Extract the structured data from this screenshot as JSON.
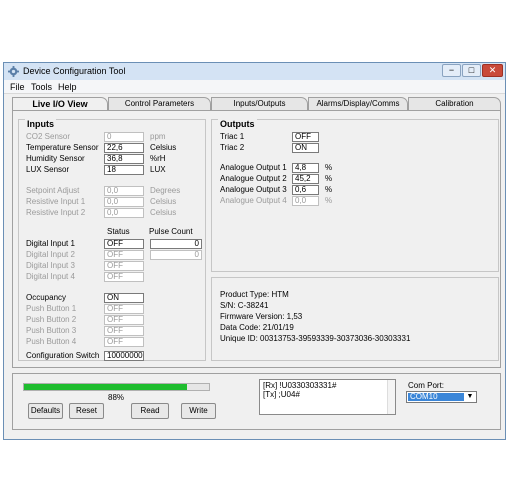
{
  "window": {
    "title": "Device Configuration Tool",
    "minimize": "−",
    "maximize": "□",
    "close": "✕"
  },
  "menu": [
    "File",
    "Tools",
    "Help"
  ],
  "tabs": [
    "Live  I/O View",
    "Control Parameters",
    "Inputs/Outputs",
    "Alarms/Display/Comms",
    "Calibration"
  ],
  "inputs": {
    "title": "Inputs",
    "sensors": [
      {
        "label": "CO2 Sensor",
        "value": "0",
        "unit": "ppm"
      },
      {
        "label": "Temperature Sensor",
        "value": "22,6",
        "unit": "Celsius"
      },
      {
        "label": "Humidity Sensor",
        "value": "36,8",
        "unit": "%rH"
      },
      {
        "label": "LUX Sensor",
        "value": "18",
        "unit": "LUX"
      }
    ],
    "setpoints": [
      {
        "label": "Setpoint Adjust",
        "value": "0,0",
        "unit": "Degrees"
      },
      {
        "label": "Resistive Input 1",
        "value": "0,0",
        "unit": "Celsius"
      },
      {
        "label": "Resistive Input 2",
        "value": "0,0",
        "unit": "Celsius"
      }
    ],
    "status_header": "Status",
    "pulse_header": "Pulse Count",
    "digital": [
      {
        "label": "Digital Input 1",
        "value": "OFF",
        "pulse": "0"
      },
      {
        "label": "Digital Input 2",
        "value": "OFF",
        "pulse": "0"
      },
      {
        "label": "Digital Input 3",
        "value": "OFF"
      },
      {
        "label": "Digital Input 4",
        "value": "OFF"
      }
    ],
    "occupancy": {
      "label": "Occupancy",
      "value": "ON"
    },
    "push": [
      {
        "label": "Push Button 1",
        "value": "OFF"
      },
      {
        "label": "Push Button 2",
        "value": "OFF"
      },
      {
        "label": "Push Button 3",
        "value": "OFF"
      },
      {
        "label": "Push Button 4",
        "value": "OFF"
      }
    ],
    "config_switch": {
      "label": "Configuration Switch",
      "value": "10000000"
    }
  },
  "outputs": {
    "title": "Outputs",
    "triacs": [
      {
        "label": "Triac 1",
        "value": "OFF"
      },
      {
        "label": "Triac 2",
        "value": "ON"
      }
    ],
    "analogue": [
      {
        "label": "Analogue Output 1",
        "value": "4,8",
        "unit": "%"
      },
      {
        "label": "Analogue Output 2",
        "value": "45,2",
        "unit": "%"
      },
      {
        "label": "Analogue Output 3",
        "value": "0,6",
        "unit": "%"
      },
      {
        "label": "Analogue Output 4",
        "value": "0,0",
        "unit": "%"
      }
    ]
  },
  "product": {
    "type": "Product Type: HTM",
    "serial": "S/N: C-38241",
    "firmware": "Firmware Version: 1,53",
    "datecode": "Data Code: 21/01/19",
    "unique": "Unique ID: 00313753-39593339-30373036-30303331"
  },
  "bottom": {
    "progress_percent": 88,
    "progress_label": "88%",
    "buttons": {
      "defaults": "Defaults",
      "reset": "Reset",
      "read": "Read",
      "write": "Write"
    },
    "comms": [
      "[Rx] !U0330303331#",
      "[Tx] ;U04#"
    ],
    "com_port_label": "Com Port:",
    "com_port_value": "COM10"
  },
  "colors": {
    "progress": "#1fbd2f",
    "selection": "#3b86d8",
    "close": "#c94a3a"
  }
}
